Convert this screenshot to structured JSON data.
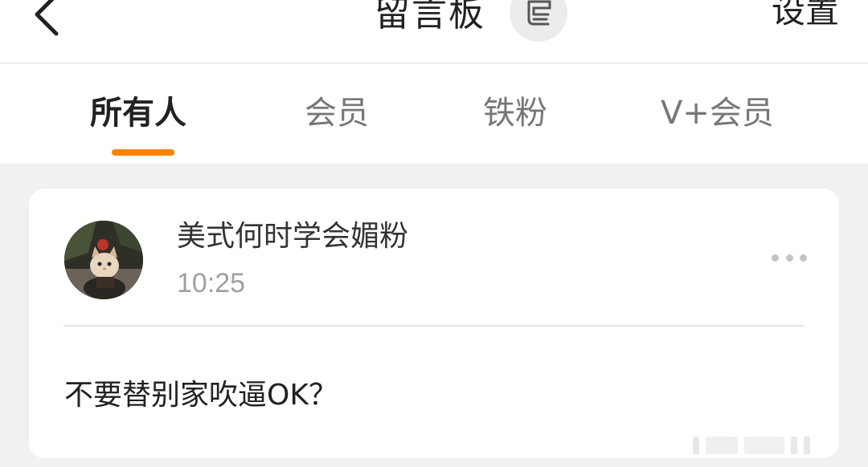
{
  "header": {
    "title": "留言板",
    "settings_label": "设置",
    "back_icon": "chevron-left-icon",
    "badge_icon": "message-board-icon"
  },
  "tabs": [
    {
      "label": "所有人",
      "active": true
    },
    {
      "label": "会员",
      "active": false
    },
    {
      "label": "铁粉",
      "active": false
    },
    {
      "label": "V+会员",
      "active": false
    }
  ],
  "accent_color": "#ff8200",
  "post": {
    "username": "美式何时学会媚粉",
    "time": "10:25",
    "content": "不要替别家吹逼OK？",
    "more_icon": "more-horizontal-icon"
  }
}
